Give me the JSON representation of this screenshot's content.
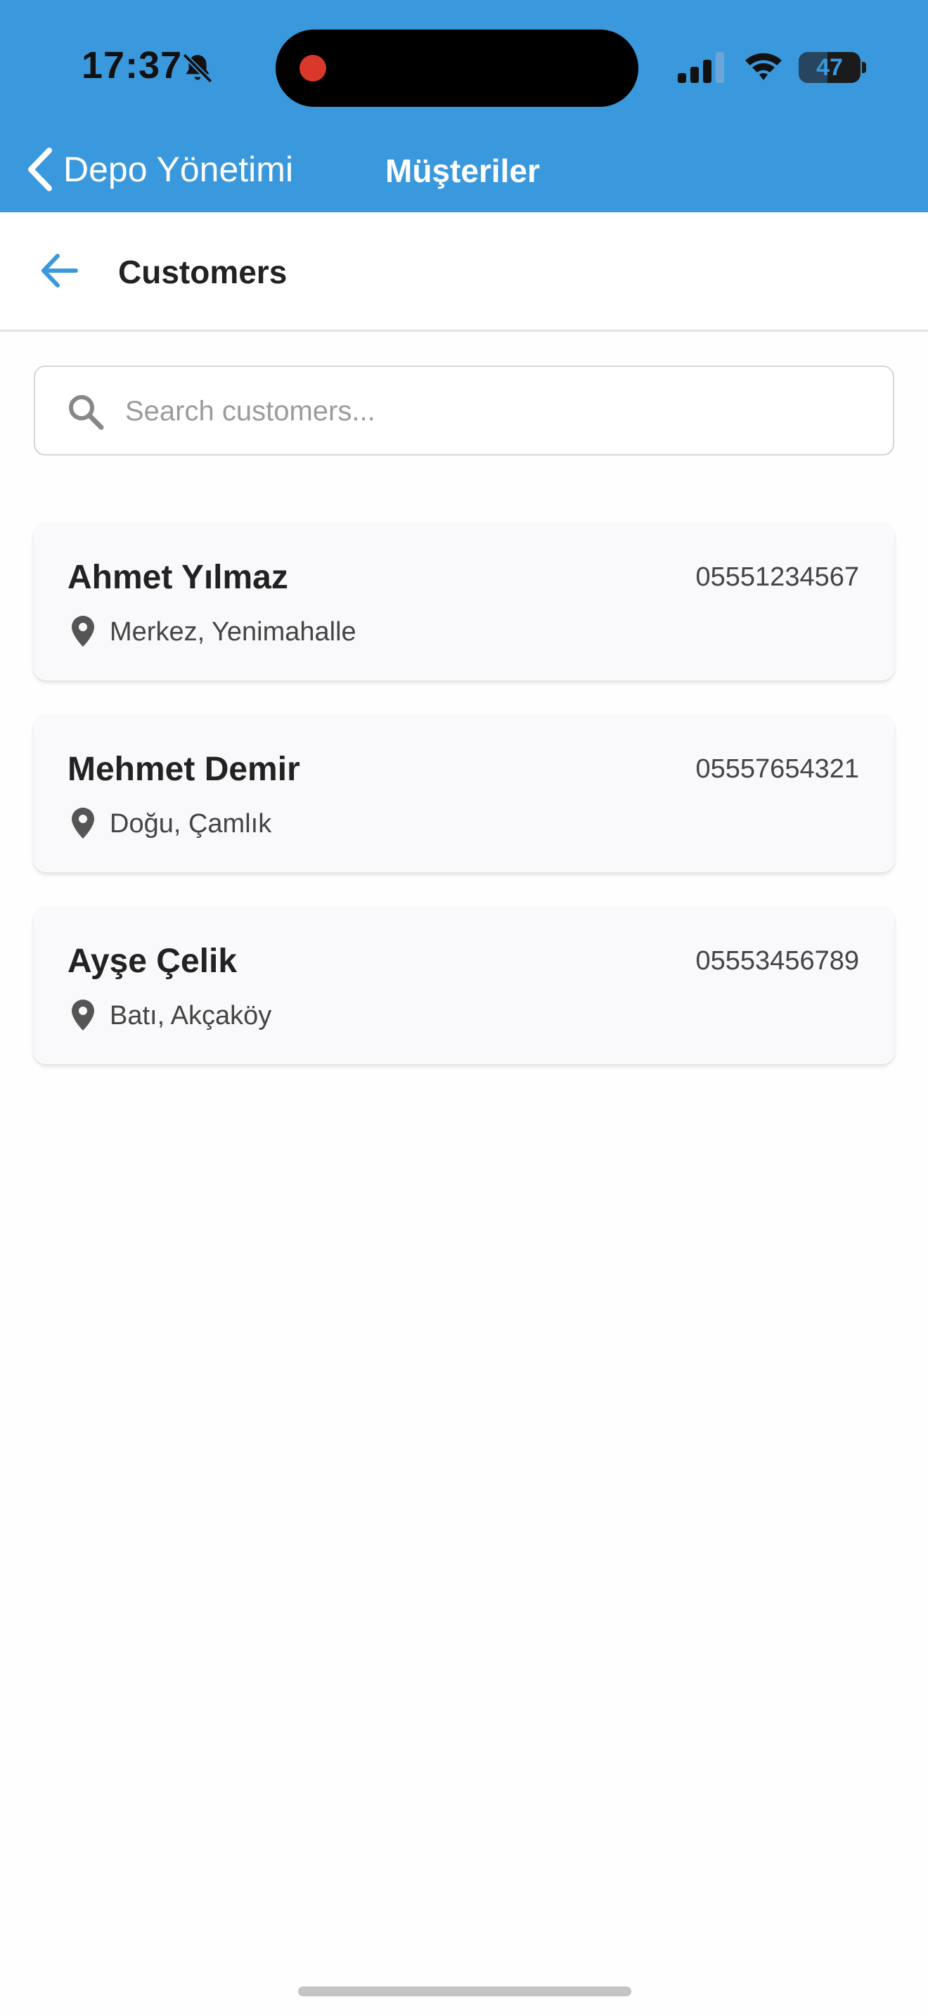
{
  "status_bar": {
    "time": "17:37",
    "battery_text": "47",
    "battery_level": 0.47
  },
  "nav": {
    "back_label": "Depo Yönetimi",
    "title": "Müşteriler"
  },
  "header": {
    "title": "Customers"
  },
  "search": {
    "placeholder": "Search customers...",
    "value": ""
  },
  "customers": [
    {
      "name": "Ahmet Yılmaz",
      "phone": "05551234567",
      "location": "Merkez, Yenimahalle"
    },
    {
      "name": "Mehmet Demir",
      "phone": "05557654321",
      "location": "Doğu, Çamlık"
    },
    {
      "name": "Ayşe Çelik",
      "phone": "05553456789",
      "location": "Batı, Akçaköy"
    }
  ],
  "colors": {
    "accent": "#3a99dc",
    "record": "#d9382b",
    "card_bg": "#f9f8fb"
  },
  "icons": {
    "bell": "bell-slash-icon",
    "back": "arrow-left-icon",
    "search": "magnifier-icon",
    "location": "map-pin-icon"
  }
}
